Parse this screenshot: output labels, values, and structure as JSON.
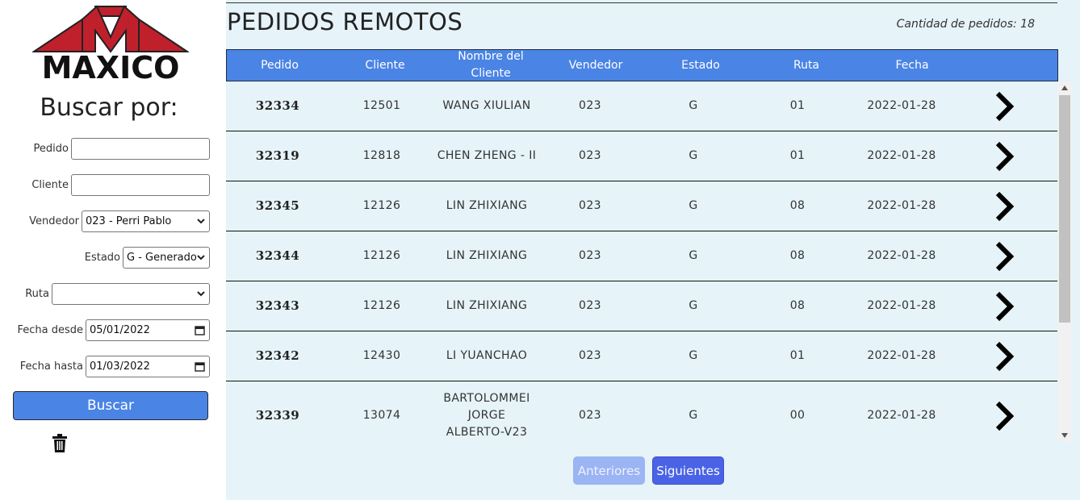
{
  "colors": {
    "accent": "#4a84e5",
    "logo_red": "#c0202c",
    "main_bg": "#e6f3f8",
    "next_button": "#4a63e6",
    "prev_button_disabled": "#9bb4f4"
  },
  "logo": {
    "text": "MAXICO"
  },
  "sidebar": {
    "title": "Buscar por:",
    "fields": {
      "pedido": {
        "label": "Pedido",
        "value": ""
      },
      "cliente": {
        "label": "Cliente",
        "value": ""
      },
      "vendedor": {
        "label": "Vendedor",
        "value": "023 - Perri Pablo"
      },
      "estado": {
        "label": "Estado",
        "value": "G - Generado"
      },
      "ruta": {
        "label": "Ruta",
        "value": ""
      },
      "fecha_desde": {
        "label": "Fecha desde",
        "value": "05/01/2022"
      },
      "fecha_hasta": {
        "label": "Fecha hasta",
        "value": "01/03/2022"
      }
    },
    "search_button": "Buscar",
    "clear_icon": "trash-icon"
  },
  "main": {
    "title": "PEDIDOS REMOTOS",
    "order_count": "Cantidad de pedidos: 18",
    "columns": [
      "Pedido",
      "Cliente",
      "Nombre del Cliente",
      "Vendedor",
      "Estado",
      "Ruta",
      "Fecha"
    ],
    "rows": [
      {
        "pedido": "32334",
        "cliente": "12501",
        "nombre": "WANG XIULIAN",
        "vendedor": "023",
        "estado": "G",
        "ruta": "01",
        "fecha": "2022-01-28"
      },
      {
        "pedido": "32319",
        "cliente": "12818",
        "nombre": "CHEN ZHENG - II",
        "vendedor": "023",
        "estado": "G",
        "ruta": "01",
        "fecha": "2022-01-28"
      },
      {
        "pedido": "32345",
        "cliente": "12126",
        "nombre": "LIN ZHIXIANG",
        "vendedor": "023",
        "estado": "G",
        "ruta": "08",
        "fecha": "2022-01-28"
      },
      {
        "pedido": "32344",
        "cliente": "12126",
        "nombre": "LIN ZHIXIANG",
        "vendedor": "023",
        "estado": "G",
        "ruta": "08",
        "fecha": "2022-01-28"
      },
      {
        "pedido": "32343",
        "cliente": "12126",
        "nombre": "LIN ZHIXIANG",
        "vendedor": "023",
        "estado": "G",
        "ruta": "08",
        "fecha": "2022-01-28"
      },
      {
        "pedido": "32342",
        "cliente": "12430",
        "nombre": "LI YUANCHAO",
        "vendedor": "023",
        "estado": "G",
        "ruta": "01",
        "fecha": "2022-01-28"
      },
      {
        "pedido": "32339",
        "cliente": "13074",
        "nombre": "BARTOLOMMEI JORGE ALBERTO-V23",
        "vendedor": "023",
        "estado": "G",
        "ruta": "00",
        "fecha": "2022-01-28"
      }
    ],
    "row_action_icon": "chevron-right-icon",
    "pagination": {
      "prev": "Anteriores",
      "next": "Siguientes",
      "prev_disabled": true
    }
  }
}
